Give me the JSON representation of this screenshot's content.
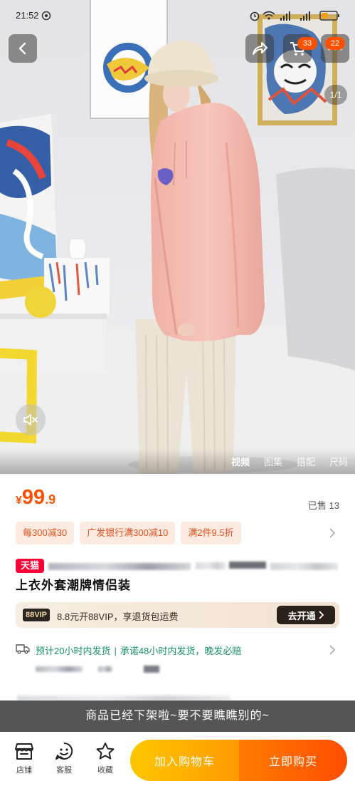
{
  "status_bar": {
    "time": "21:52"
  },
  "hero": {
    "page_indicator": "1/1",
    "cart_badge": "33",
    "more_badge": "22",
    "media_tabs": [
      "视频",
      "图集",
      "搭配",
      "尺码"
    ],
    "active_media_tab": "视频"
  },
  "price": {
    "currency": "¥",
    "integer": "99",
    "decimal": ".9",
    "sold": "已售 13"
  },
  "coupons": [
    "每300减30",
    "广发银行满300减10",
    "满2件9.5折"
  ],
  "title": {
    "store_badge": "天猫",
    "line2": "上衣外套潮牌情侣装"
  },
  "vip": {
    "badge": "88VIP",
    "text": "8.8元开88VIP，享退货包运费",
    "button": "去开通"
  },
  "shipping": {
    "estimate": "预计20小时内发货",
    "separator": "|",
    "promise": "承诺48小时内发货，晚发必赔"
  },
  "notice_banner": "商品已经下架啦~要不要瞧瞧别的~",
  "bottom_bar": {
    "shop": "店铺",
    "service": "客服",
    "favorite": "收藏",
    "add_to_cart": "加入购物车",
    "buy_now": "立即购买"
  },
  "colors": {
    "accent": "#ff5000",
    "tmall_red": "#ff0036",
    "coupon_bg": "#fdebe1",
    "shipping_green": "#17916d",
    "cart_button": "#ffb300",
    "buy_button": "#ff5a00",
    "banner": "#4a4a4a"
  }
}
